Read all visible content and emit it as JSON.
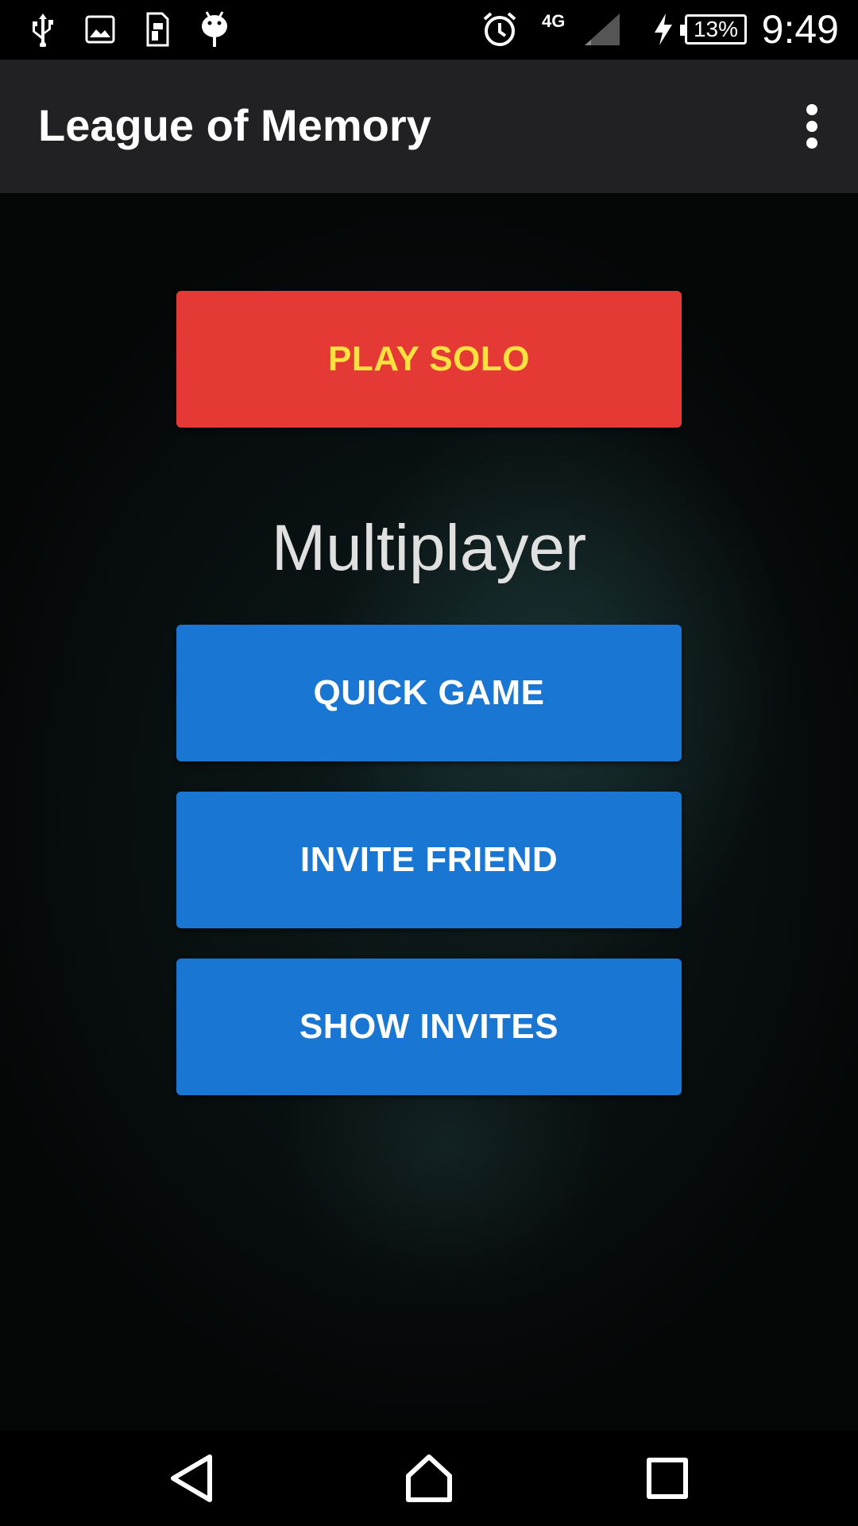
{
  "status_bar": {
    "icons": [
      "usb-icon",
      "image-icon",
      "sim-icon",
      "android-icon",
      "alarm-icon",
      "signal-icon",
      "charging-icon"
    ],
    "network": "4G",
    "battery": "13%",
    "time": "9:49"
  },
  "app_bar": {
    "title": "League of Memory",
    "menu_icon": "more-vert-icon"
  },
  "main": {
    "play_solo": "PLAY SOLO",
    "multiplayer_heading": "Multiplayer",
    "quick_game": "QUICK GAME",
    "invite_friend": "INVITE FRIEND",
    "show_invites": "SHOW INVITES"
  },
  "nav_bar": {
    "icons": [
      "back-icon",
      "home-icon",
      "recents-icon"
    ]
  },
  "colors": {
    "solo_button": "#e53935",
    "solo_text": "#fde140",
    "multiplayer_buttons": "#1976d2",
    "app_bar": "#212123"
  }
}
